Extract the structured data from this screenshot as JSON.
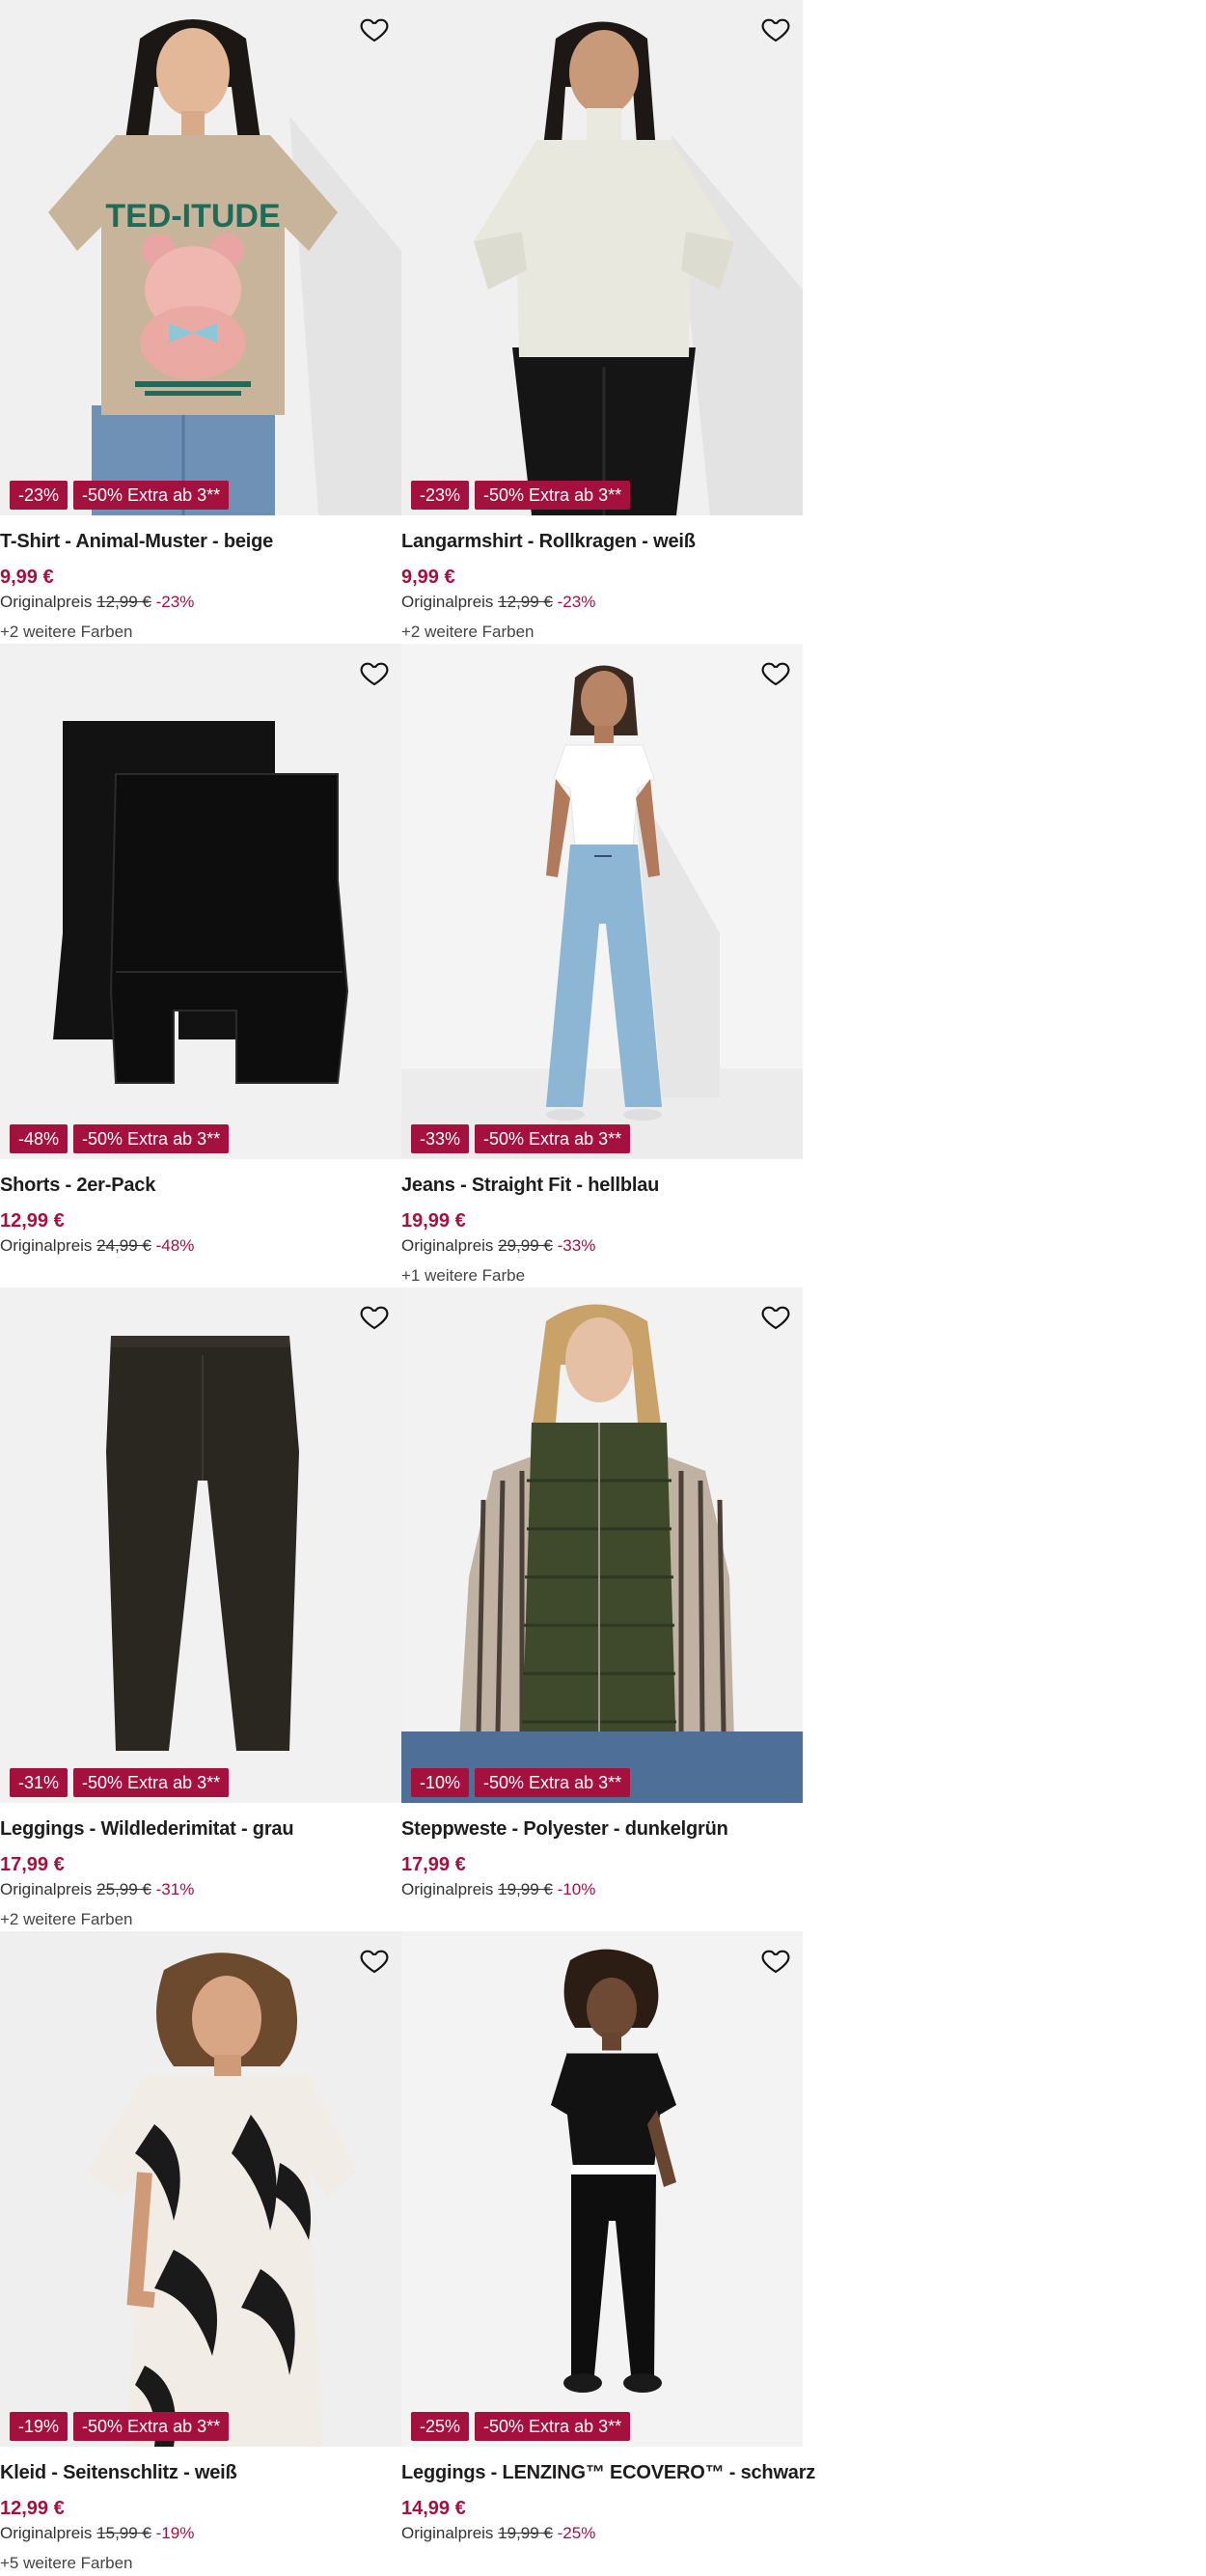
{
  "products": [
    {
      "title": "T-Shirt - Animal-Muster - beige",
      "price": "9,99 €",
      "orig_label": "Originalpreis",
      "orig_price": "12,99 €",
      "orig_pct": "-23%",
      "badge_discount": "-23%",
      "badge_extra": "-50% Extra ab 3**",
      "colors": "+2 weitere Farben",
      "image": "tshirt-animal-beige"
    },
    {
      "title": "Langarmshirt - Rollkragen - weiß",
      "price": "9,99 €",
      "orig_label": "Originalpreis",
      "orig_price": "12,99 €",
      "orig_pct": "-23%",
      "badge_discount": "-23%",
      "badge_extra": "-50% Extra ab 3**",
      "colors": "+2 weitere Farben",
      "image": "turtleneck-white"
    },
    {
      "title": "Shorts - 2er-Pack",
      "price": "12,99 €",
      "orig_label": "Originalpreis",
      "orig_price": "24,99 €",
      "orig_pct": "-48%",
      "badge_discount": "-48%",
      "badge_extra": "-50% Extra ab 3**",
      "colors": "",
      "image": "shorts-black-2pack"
    },
    {
      "title": "Jeans - Straight Fit - hellblau",
      "price": "19,99 €",
      "orig_label": "Originalpreis",
      "orig_price": "29,99 €",
      "orig_pct": "-33%",
      "badge_discount": "-33%",
      "badge_extra": "-50% Extra ab 3**",
      "colors": "+1 weitere Farbe",
      "image": "jeans-light-blue"
    },
    {
      "title": "Leggings - Wildlederimitat - grau",
      "price": "17,99 €",
      "orig_label": "Originalpreis",
      "orig_price": "25,99 €",
      "orig_pct": "-31%",
      "badge_discount": "-31%",
      "badge_extra": "-50% Extra ab 3**",
      "colors": "+2 weitere Farben",
      "image": "leggings-suede-grey"
    },
    {
      "title": "Steppweste - Polyester - dunkelgrün",
      "price": "17,99 €",
      "orig_label": "Originalpreis",
      "orig_price": "19,99 €",
      "orig_pct": "-10%",
      "badge_discount": "-10%",
      "badge_extra": "-50% Extra ab 3**",
      "colors": "",
      "image": "vest-dark-green"
    },
    {
      "title": "Kleid - Seitenschlitz - weiß",
      "price": "12,99 €",
      "orig_label": "Originalpreis",
      "orig_price": "15,99 €",
      "orig_pct": "-19%",
      "badge_discount": "-19%",
      "badge_extra": "-50% Extra ab 3**",
      "colors": "+5 weitere Farben",
      "image": "dress-palm-print"
    },
    {
      "title": "Leggings - LENZING™ ECOVERO™ - schwarz",
      "price": "14,99 €",
      "orig_label": "Originalpreis",
      "orig_price": "19,99 €",
      "orig_pct": "-25%",
      "badge_discount": "-25%",
      "badge_extra": "-50% Extra ab 3**",
      "colors": "",
      "image": "leggings-black"
    }
  ],
  "icons": {
    "wishlist": "heart-outline-icon"
  },
  "colors": {
    "accent": "#a5113f",
    "image_bg": "#f1f1f1"
  }
}
